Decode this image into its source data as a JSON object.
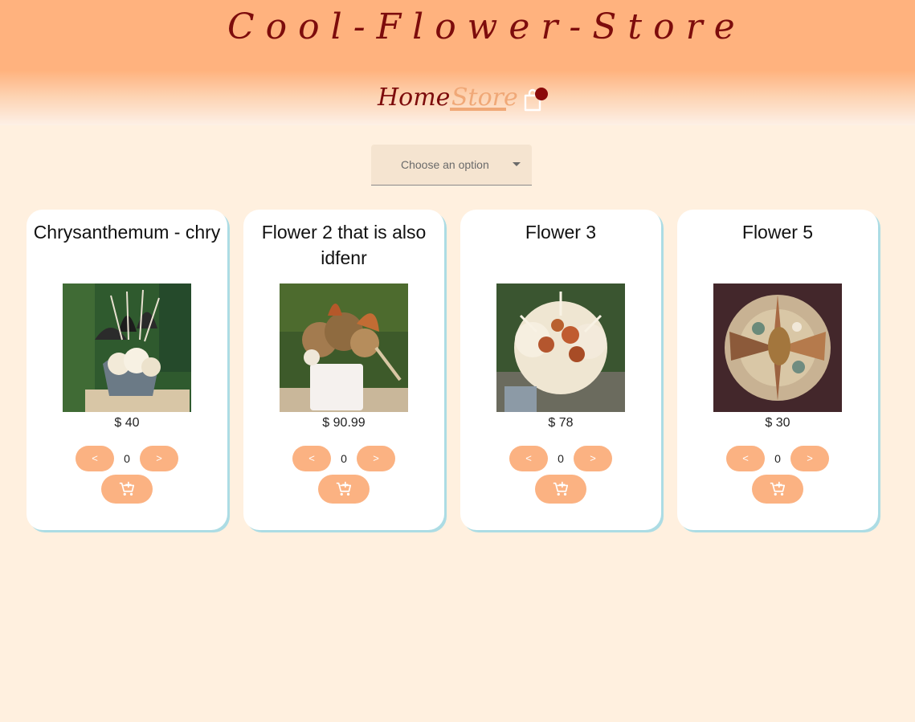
{
  "header": {
    "site_title": "Cool-Flower-Store",
    "nav": {
      "home": "Home",
      "store": "Store"
    },
    "cart_icon": "shopping-bag-icon"
  },
  "filter": {
    "placeholder": "Choose an option"
  },
  "products": [
    {
      "title": "Chrysanthemum - chry",
      "price": "$ 40",
      "quantity": "0",
      "dec": "<",
      "inc": ">"
    },
    {
      "title": "Flower 2 that is also idfenr",
      "price": "$ 90.99",
      "quantity": "0",
      "dec": "<",
      "inc": ">"
    },
    {
      "title": "Flower 3",
      "price": "$ 78",
      "quantity": "0",
      "dec": "<",
      "inc": ">"
    },
    {
      "title": "Flower 5",
      "price": "$ 30",
      "quantity": "0",
      "dec": "<",
      "inc": ">"
    }
  ],
  "colors": {
    "header_accent": "#ffb27e",
    "title_color": "#7d0c0c",
    "button": "#fbb282",
    "background": "#fff0df",
    "card_shadow": "#acdce4"
  }
}
